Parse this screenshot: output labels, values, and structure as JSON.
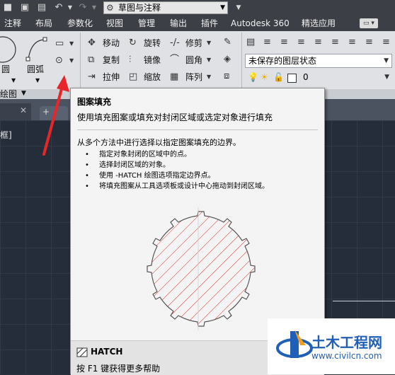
{
  "quick_access": {
    "workspace": "草图与注释",
    "icons": [
      "app-menu-icon",
      "save-icon",
      "print-icon",
      "undo-icon",
      "redo-icon",
      "gear-icon"
    ]
  },
  "tabs": [
    "注释",
    "布局",
    "参数化",
    "视图",
    "管理",
    "输出",
    "插件",
    "Autodesk 360",
    "精选应用"
  ],
  "draw_panel": {
    "circle": "圆",
    "arc": "圆弧",
    "panel_label": "绘图"
  },
  "modify_panel": {
    "move": "移动",
    "rotate": "旋转",
    "trim": "修剪",
    "copy": "复制",
    "mirror": "镜像",
    "fillet": "圆角",
    "stretch": "拉伸",
    "scale": "缩放",
    "array": "阵列"
  },
  "layers_panel": {
    "layer_state": "未保存的图层状态",
    "current_layer": "0"
  },
  "drawing": {
    "viewport_label": "框]"
  },
  "tooltip": {
    "title": "图案填充",
    "description": "使用填充图案或填充对封闭区域或选定对象进行填充",
    "how_title": "从多个方法中进行选择以指定图案填充的边界。",
    "methods": [
      "指定对象封闭的区域中的点。",
      "选择封闭区域的对象。",
      "使用 -HATCH 绘图选项指定边界点。",
      "将填充图案从工具选项板或设计中心拖动到封闭区域。"
    ],
    "command": "HATCH",
    "help": "按 F1 键获得更多帮助"
  },
  "watermark": {
    "brand": "土木工程网",
    "url": "www.civilcn.com"
  },
  "colors": {
    "annotation_arrow": "#e8262a",
    "hatch": "#e0322e"
  }
}
